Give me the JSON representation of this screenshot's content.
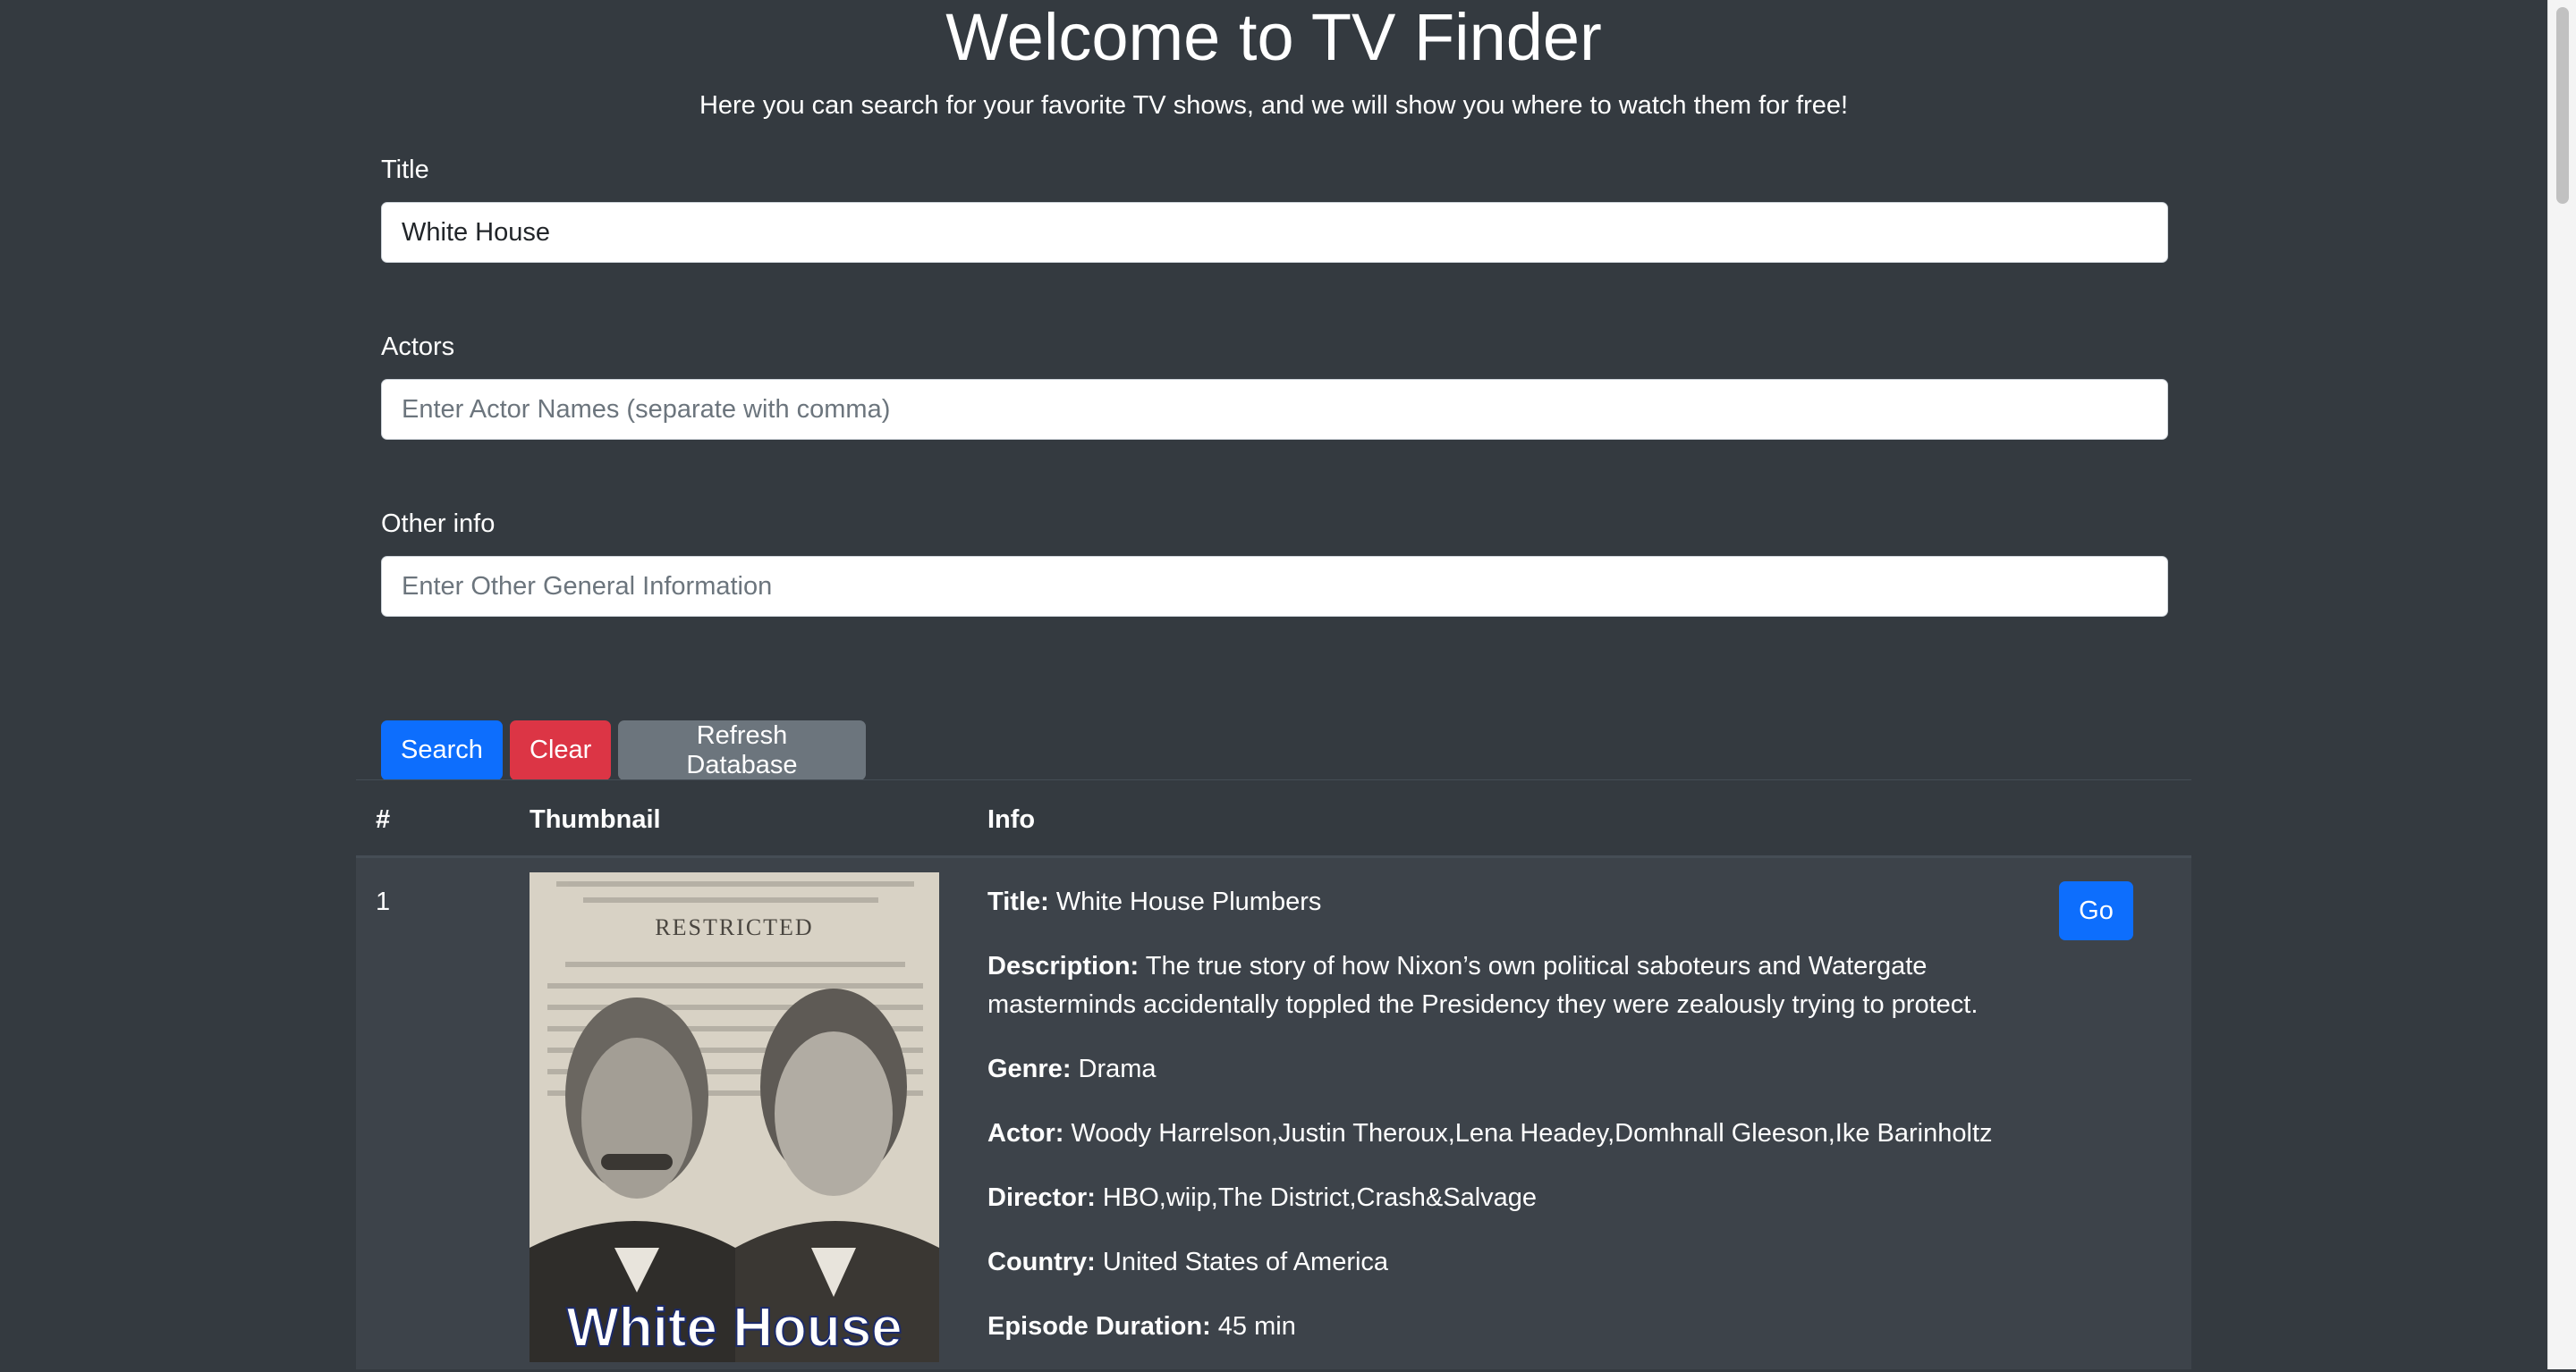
{
  "header": {
    "title": "Welcome to TV Finder",
    "subtitle": "Here you can search for your favorite TV shows, and we will show you where to watch them for free!"
  },
  "form": {
    "title_label": "Title",
    "title_value": "White House",
    "actors_label": "Actors",
    "actors_placeholder": "Enter Actor Names (separate with comma)",
    "other_label": "Other info",
    "other_placeholder": "Enter Other General Information"
  },
  "buttons": {
    "search": "Search",
    "clear": "Clear",
    "refresh": "Refresh Database"
  },
  "table": {
    "headers": [
      "#",
      "Thumbnail",
      "Info"
    ],
    "rows": [
      {
        "num": "1",
        "thumbnail_caption": "White House",
        "thumbnail_stamp": "RESTRICTED",
        "fields": [
          {
            "label": "Title:",
            "value": "White House Plumbers"
          },
          {
            "label": "Description:",
            "value": "The true story of how Nixon’s own political saboteurs and Watergate masterminds accidentally toppled the Presidency they were zealously trying to protect."
          },
          {
            "label": "Genre:",
            "value": "Drama"
          },
          {
            "label": "Actor:",
            "value": "Woody Harrelson,Justin Theroux,Lena Headey,Domhnall Gleeson,Ike Barinholtz"
          },
          {
            "label": "Director:",
            "value": "HBO,wiip,The District,Crash&Salvage"
          },
          {
            "label": "Country:",
            "value": "United States of America"
          },
          {
            "label": "Episode Duration:",
            "value": "45 min"
          }
        ],
        "go_label": "Go"
      }
    ]
  },
  "colors": {
    "background": "#343a40",
    "primary": "#0d6efd",
    "danger": "#dc3545",
    "secondary": "#6c757d"
  }
}
